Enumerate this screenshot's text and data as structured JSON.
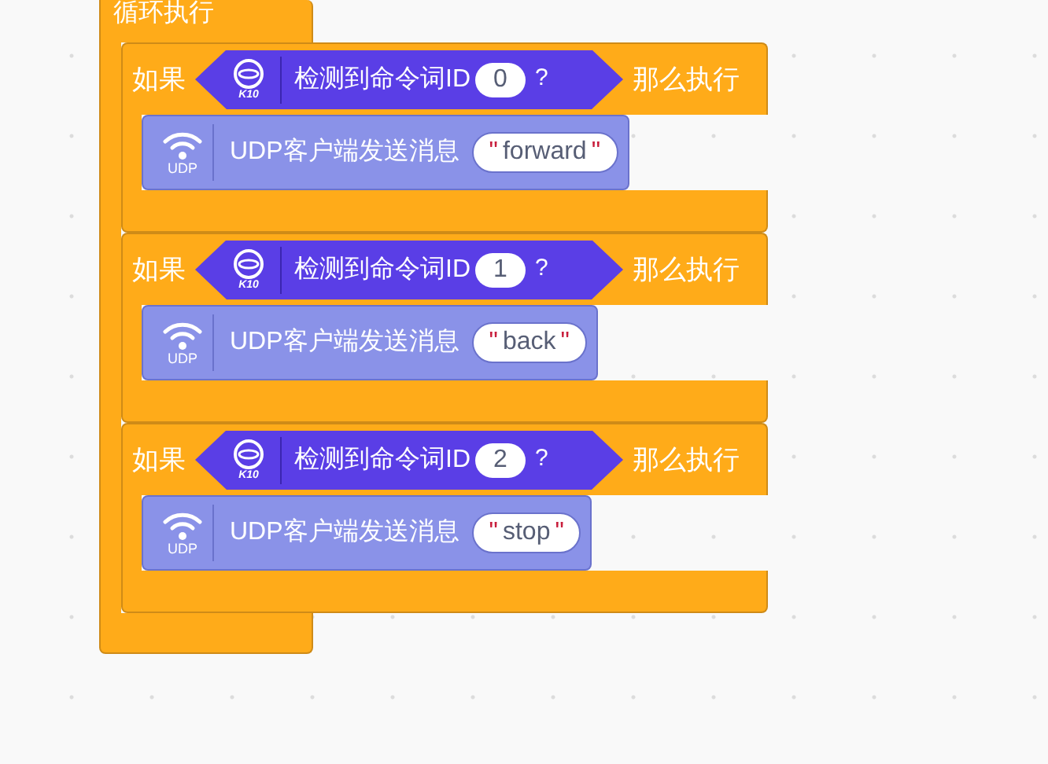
{
  "forever_block": {
    "label": "循环执行",
    "blocks": [
      {
        "if_label": "如果",
        "condition": {
          "badge": "K10",
          "label": "检测到命令词ID",
          "value": "0",
          "mark": "?"
        },
        "then_label": "那么执行",
        "body": [
          {
            "badge": "UDP",
            "label": "UDP客户端发送消息",
            "open_quote": "\"",
            "value": "forward",
            "close_quote": "\""
          }
        ]
      },
      {
        "if_label": "如果",
        "condition": {
          "badge": "K10",
          "label": "检测到命令词ID",
          "value": "1",
          "mark": "?"
        },
        "then_label": "那么执行",
        "body": [
          {
            "badge": "UDP",
            "label": "UDP客户端发送消息",
            "open_quote": "\"",
            "value": "back",
            "close_quote": "\""
          }
        ]
      },
      {
        "if_label": "如果",
        "condition": {
          "badge": "K10",
          "label": "检测到命令词ID",
          "value": "2",
          "mark": "?"
        },
        "then_label": "那么执行",
        "body": [
          {
            "badge": "UDP",
            "label": "UDP客户端发送消息",
            "open_quote": "\"",
            "value": "stop",
            "close_quote": "\""
          }
        ]
      }
    ]
  }
}
